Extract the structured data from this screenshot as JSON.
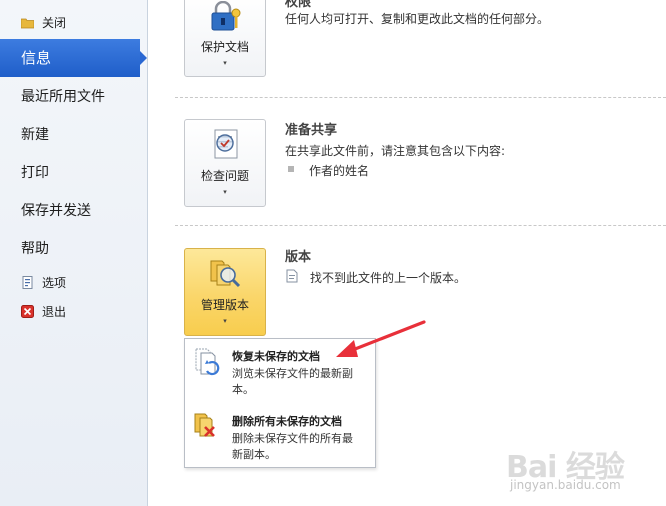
{
  "sidebar": {
    "close_label": "关闭",
    "selected_label": "信息",
    "items": [
      "最近所用文件",
      "新建",
      "打印",
      "保存并发送",
      "帮助"
    ],
    "options_label": "选项",
    "exit_label": "退出"
  },
  "protect": {
    "title_partial": "权限",
    "description": "任何人均可打开、复制和更改此文档的任何部分。",
    "button_label": "保护文档",
    "dropdown_glyph": "▾"
  },
  "prepare": {
    "title": "准备共享",
    "description": "在共享此文件前，请注意其包含以下内容:",
    "bullet_item": "作者的姓名",
    "button_label": "检查问题",
    "dropdown_glyph": "▾"
  },
  "versions": {
    "title": "版本",
    "note": "找不到此文件的上一个版本。",
    "button_label": "管理版本",
    "dropdown_glyph": "▾"
  },
  "menu": {
    "items": [
      {
        "title": "恢复未保存的文档",
        "desc": "浏览未保存文件的最新副本。"
      },
      {
        "title": "删除所有未保存的文档",
        "desc": "删除未保存文件的所有最新副本。"
      }
    ]
  },
  "watermark": {
    "logo_text": "Bai 经验",
    "url": "jingyan.baidu.com"
  },
  "colors": {
    "selected": "#2a68d3",
    "hot_button": "#fad66a",
    "arrow": "#e8303a"
  }
}
